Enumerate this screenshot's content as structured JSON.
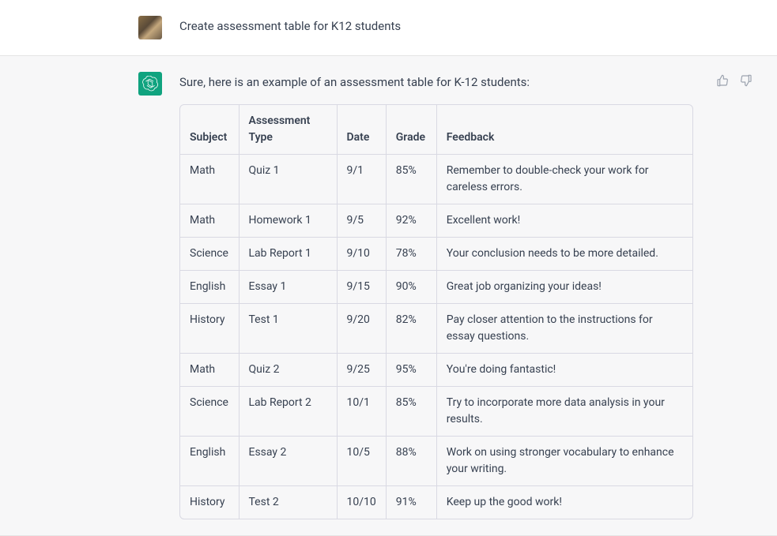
{
  "user": {
    "prompt": "Create assessment table for K12 students"
  },
  "assistant": {
    "intro": "Sure, here is an example of an assessment table for K-12 students:",
    "table": {
      "headers": {
        "subject": "Subject",
        "type": "Assessment Type",
        "date": "Date",
        "grade": "Grade",
        "feedback": "Feedback"
      },
      "rows": [
        {
          "subject": "Math",
          "type": "Quiz 1",
          "date": "9/1",
          "grade": "85%",
          "feedback": "Remember to double-check your work for careless errors."
        },
        {
          "subject": "Math",
          "type": "Homework 1",
          "date": "9/5",
          "grade": "92%",
          "feedback": "Excellent work!"
        },
        {
          "subject": "Science",
          "type": "Lab Report 1",
          "date": "9/10",
          "grade": "78%",
          "feedback": "Your conclusion needs to be more detailed."
        },
        {
          "subject": "English",
          "type": "Essay 1",
          "date": "9/15",
          "grade": "90%",
          "feedback": "Great job organizing your ideas!"
        },
        {
          "subject": "History",
          "type": "Test 1",
          "date": "9/20",
          "grade": "82%",
          "feedback": "Pay closer attention to the instructions for essay questions."
        },
        {
          "subject": "Math",
          "type": "Quiz 2",
          "date": "9/25",
          "grade": "95%",
          "feedback": "You're doing fantastic!"
        },
        {
          "subject": "Science",
          "type": "Lab Report 2",
          "date": "10/1",
          "grade": "85%",
          "feedback": "Try to incorporate more data analysis in your results."
        },
        {
          "subject": "English",
          "type": "Essay 2",
          "date": "10/5",
          "grade": "88%",
          "feedback": "Work on using stronger vocabulary to enhance your writing."
        },
        {
          "subject": "History",
          "type": "Test 2",
          "date": "10/10",
          "grade": "91%",
          "feedback": "Keep up the good work!"
        }
      ]
    }
  },
  "icons": {
    "thumb_up": "thumb-up-icon",
    "thumb_down": "thumb-down-icon",
    "assistant": "openai-icon"
  }
}
